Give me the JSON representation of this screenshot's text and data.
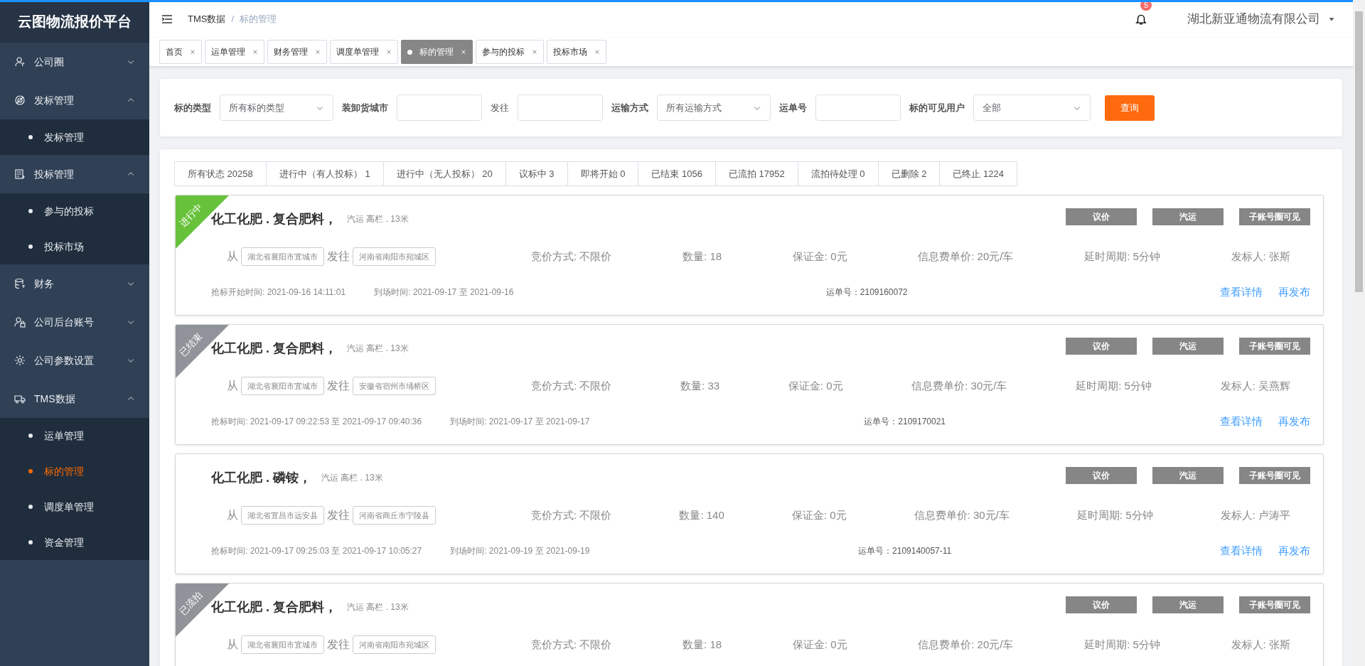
{
  "sidebar": {
    "brand": "云图物流报价平台",
    "items": [
      {
        "label": "公司圈",
        "expanded": false
      },
      {
        "label": "发标管理",
        "expanded": true,
        "children": [
          {
            "label": "发标管理",
            "selected": false
          }
        ]
      },
      {
        "label": "投标管理",
        "expanded": true,
        "children": [
          {
            "label": "参与的投标",
            "selected": false
          },
          {
            "label": "投标市场",
            "selected": false
          }
        ]
      },
      {
        "label": "财务",
        "expanded": false
      },
      {
        "label": "公司后台账号",
        "expanded": false
      },
      {
        "label": "公司参数设置",
        "expanded": false
      },
      {
        "label": "TMS数据",
        "expanded": true,
        "children": [
          {
            "label": "运单管理",
            "selected": false
          },
          {
            "label": "标的管理",
            "selected": true
          },
          {
            "label": "调度单管理",
            "selected": false
          },
          {
            "label": "资金管理",
            "selected": false
          }
        ]
      }
    ]
  },
  "header": {
    "breadcrumb": [
      "TMS数据",
      "标的管理"
    ],
    "breadcrumb_separator": "/",
    "notifications": "5",
    "company": "湖北新亚通物流有限公司"
  },
  "tabs": [
    {
      "label": "首页",
      "selected": false
    },
    {
      "label": "运单管理",
      "selected": false
    },
    {
      "label": "财务管理",
      "selected": false
    },
    {
      "label": "调度单管理",
      "selected": false
    },
    {
      "label": "标的管理",
      "selected": true
    },
    {
      "label": "参与的投标",
      "selected": false
    },
    {
      "label": "投标市场",
      "selected": false
    }
  ],
  "filters": [
    {
      "kind": "select",
      "label": "标的类型",
      "value": "所有标的类型"
    },
    {
      "kind": "input",
      "label": "装卸货城市"
    },
    {
      "kind": "input",
      "label": "发往"
    },
    {
      "kind": "select",
      "label": "运输方式",
      "value": "所有运输方式"
    },
    {
      "kind": "input",
      "label": "运单号"
    },
    {
      "kind": "select",
      "label": "标的可见用户",
      "value": "全部"
    }
  ],
  "query_button": "查询",
  "status_filters": [
    {
      "label": "所有状态 20258",
      "selected": false
    },
    {
      "label": "进行中（有人投标） 1",
      "selected": false
    },
    {
      "label": "进行中（无人投标） 20",
      "selected": false
    },
    {
      "label": "议标中 3",
      "selected": false
    },
    {
      "label": "即将开始 0",
      "selected": false
    },
    {
      "label": "已结束 1056",
      "selected": false
    },
    {
      "label": "已流拍 17952",
      "selected": false
    },
    {
      "label": "流拍待处理 0",
      "selected": false
    },
    {
      "label": "已删除 2",
      "selected": false
    },
    {
      "label": "已终止 1224",
      "selected": false
    }
  ],
  "listings": [
    {
      "ribbon": {
        "label": "进行中",
        "color": "#67c23a"
      },
      "title": "化工化肥 . 复合肥料，",
      "subtitle": "汽运 高栏 . 13米",
      "tags": [
        "议价",
        "汽运",
        "子账号圈可见"
      ],
      "from_label": "从",
      "from": "湖北省襄阳市宜城市",
      "to_label": "发往",
      "to": "河南省南阳市宛城区",
      "details": [
        "竞价方式: 不限价",
        "数量: 18",
        "保证金: 0元",
        "信息费单价: 20元/车",
        "延时周期: 5分钟",
        "发标人: 张斯"
      ],
      "bid_time": "抢标开始时间: 2021-09-16 14:11:01",
      "arrival_time": "到场时间: 2021-09-17 至 2021-09-16",
      "waybill": "运单号：2109160072",
      "actions": [
        "查看详情",
        "再发布"
      ]
    },
    {
      "ribbon": {
        "label": "已结束",
        "color": "#909399"
      },
      "title": "化工化肥 . 复合肥料，",
      "subtitle": "汽运 高栏 . 13米",
      "tags": [
        "议价",
        "汽运",
        "子账号圈可见"
      ],
      "from_label": "从",
      "from": "湖北省襄阳市宜城市",
      "to_label": "发往",
      "to": "安徽省宿州市埇桥区",
      "details": [
        "竞价方式: 不限价",
        "数量: 33",
        "保证金: 0元",
        "信息费单价: 30元/车",
        "延时周期: 5分钟",
        "发标人: 吴燕辉"
      ],
      "bid_time": "抢标时间: 2021-09-17 09:22:53 至 2021-09-17 09:40:36",
      "arrival_time": "到场时间: 2021-09-17 至 2021-09-17",
      "waybill": "运单号：2109170021",
      "actions": [
        "查看详情",
        "再发布"
      ]
    },
    {
      "title": "化工化肥 . 磷铵，",
      "subtitle": "汽运 高栏 . 13米",
      "tags": [
        "议价",
        "汽运",
        "子账号圈可见"
      ],
      "from_label": "从",
      "from": "湖北省宜昌市远安县",
      "to_label": "发往",
      "to": "河南省商丘市宁陵县",
      "details": [
        "竞价方式: 不限价",
        "数量: 140",
        "保证金: 0元",
        "信息费单价: 30元/车",
        "延时周期: 5分钟",
        "发标人: 卢涛平"
      ],
      "bid_time": "抢标时间: 2021-09-17 09:25:03 至 2021-09-17 10:05:27",
      "arrival_time": "到场时间: 2021-09-19 至 2021-09-19",
      "waybill": "运单号：2109140057-11",
      "actions": [
        "查看详情",
        "再发布"
      ]
    },
    {
      "ribbon": {
        "label": "已流拍",
        "color": "#909399"
      },
      "title": "化工化肥 . 复合肥料，",
      "subtitle": "汽运 高栏 . 13米",
      "tags": [
        "议价",
        "汽运",
        "子账号圈可见"
      ],
      "from_label": "从",
      "from": "湖北省襄阳市宜城市",
      "to_label": "发往",
      "to": "河南省南阳市宛城区",
      "details": [
        "竞价方式: 不限价",
        "数量: 18",
        "保证金: 0元",
        "信息费单价: 20元/车",
        "延时周期: 5分钟",
        "发标人: 张斯"
      ]
    }
  ]
}
